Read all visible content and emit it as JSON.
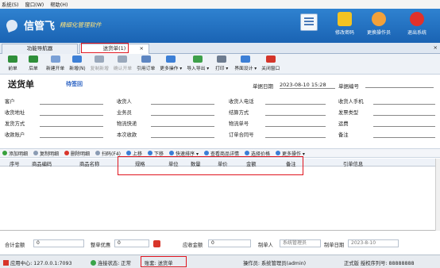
{
  "menu": [
    "系统(S)",
    "窗口(W)",
    "帮助(H)"
  ],
  "brand": {
    "name": "信管飞",
    "tagline": "精细化管理软件"
  },
  "top_buttons": [
    {
      "label": "修改密码",
      "icon": "lock-icon",
      "color": "#f3c322"
    },
    {
      "label": "更换操作员",
      "icon": "user-icon",
      "color": "#f3a13a"
    },
    {
      "label": "退出系统",
      "icon": "close-circle-icon",
      "color": "#e2312a"
    }
  ],
  "tabs": [
    {
      "label": "功能导航器",
      "active": false
    },
    {
      "label": "送货单(1)",
      "active": true
    }
  ],
  "toolbar": [
    {
      "label": "前单",
      "icon": "arrow-left-icon",
      "color": "#2f8f3a",
      "enabled": true
    },
    {
      "label": "后单",
      "icon": "arrow-right-icon",
      "color": "#2f8f3a",
      "enabled": true
    },
    {
      "label": "新建开单",
      "icon": "new-doc-icon",
      "color": "#7aa0d6",
      "enabled": true
    },
    {
      "label": "新增(N)",
      "icon": "add-icon",
      "color": "#3c7fd6",
      "enabled": true
    },
    {
      "label": "复制新增",
      "icon": "copy-icon",
      "color": "#9aa8bb",
      "enabled": false
    },
    {
      "label": "确认开单",
      "icon": "confirm-icon",
      "color": "#9aa8bb",
      "enabled": false
    },
    {
      "label": "引用订单",
      "icon": "reference-icon",
      "color": "#5e86c2",
      "enabled": true
    },
    {
      "label": "更多操作 ▾",
      "icon": "more-icon",
      "color": "#3c7fd6",
      "enabled": true
    },
    {
      "label": "导入导出 ▾",
      "icon": "import-export-icon",
      "color": "#3ea04a",
      "enabled": true
    },
    {
      "label": "打印 ▾",
      "icon": "print-icon",
      "color": "#6d7c90",
      "enabled": true
    },
    {
      "label": "界面设计 ▾",
      "icon": "design-icon",
      "color": "#3c7fd6",
      "enabled": true
    },
    {
      "label": "关闭窗口",
      "icon": "close-window-icon",
      "color": "#d4352a",
      "enabled": true
    }
  ],
  "doc": {
    "title": "送货单",
    "status": "待签回",
    "date_label": "单据日期",
    "date_value": "2023-08-10 15:28",
    "number_label": "单据编号"
  },
  "form_rows": [
    [
      "客户",
      "收货人",
      "收货人电话",
      "收货人手机"
    ],
    [
      "收货地址",
      "业务员",
      "结算方式",
      "发票类型"
    ],
    [
      "发货方式",
      "物流快递",
      "物流单号",
      "运费"
    ],
    [
      "收款账户",
      "本次收款",
      "订单合同号",
      "备注"
    ]
  ],
  "grid_tools": [
    {
      "label": "添加明细",
      "icon": "add-row-icon",
      "color": "#38a13d"
    },
    {
      "label": "复制明细",
      "icon": "copy-row-icon",
      "color": "#8a9bb3"
    },
    {
      "label": "删除明细",
      "icon": "delete-row-icon",
      "color": "#d9352b"
    },
    {
      "label": "扫码(F4)",
      "icon": "scan-icon",
      "color": "#8a9bb3"
    },
    {
      "label": "上移",
      "icon": "move-up-icon",
      "color": "#3b7ed4"
    },
    {
      "label": "下移",
      "icon": "move-down-icon",
      "color": "#3b7ed4"
    },
    {
      "label": "快速排序 ▾",
      "icon": "sort-icon",
      "color": "#3b7ed4"
    },
    {
      "label": "查看商品详情",
      "icon": "detail-icon",
      "color": "#3b7ed4"
    },
    {
      "label": "选择价格",
      "icon": "price-icon",
      "color": "#3b7ed4"
    },
    {
      "label": "更多操作 ▾",
      "icon": "more-icon",
      "color": "#3b7ed4"
    }
  ],
  "grid_columns": [
    "序号",
    "商品编码",
    "商品名称",
    "规格",
    "单位",
    "数量",
    "单价",
    "金额",
    "备注",
    "引单信息"
  ],
  "totals": {
    "total_label": "合计金额",
    "total_value": "0",
    "discount_label": "整单优惠",
    "discount_value": "0",
    "receivable_label": "应收金额",
    "receivable_value": "0",
    "creator_label": "制单人",
    "creator_value": "系统管理员",
    "created_date_label": "制单日期",
    "created_date_value": "2023-8-10"
  },
  "status": {
    "server": "应用中心: 127.0.0.1:7093",
    "connection": "连接状态: 正常",
    "account": "账套: 送货单",
    "operator": "操作员: 系统管理员(admin)",
    "license": "正式版 授权序列号: 88888888"
  },
  "colors": {
    "highlight": "#e0141e",
    "banner": "#1f6cbf",
    "link": "#2b62c3"
  }
}
